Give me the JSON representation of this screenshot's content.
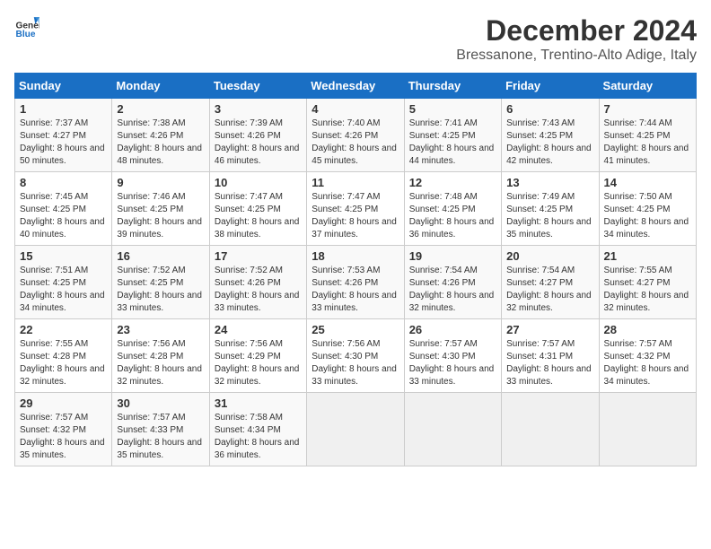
{
  "logo": {
    "text_general": "General",
    "text_blue": "Blue"
  },
  "title": "December 2024",
  "subtitle": "Bressanone, Trentino-Alto Adige, Italy",
  "days_of_week": [
    "Sunday",
    "Monday",
    "Tuesday",
    "Wednesday",
    "Thursday",
    "Friday",
    "Saturday"
  ],
  "weeks": [
    [
      {
        "day": "1",
        "sunrise": "7:37 AM",
        "sunset": "4:27 PM",
        "daylight": "8 hours and 50 minutes."
      },
      {
        "day": "2",
        "sunrise": "7:38 AM",
        "sunset": "4:26 PM",
        "daylight": "8 hours and 48 minutes."
      },
      {
        "day": "3",
        "sunrise": "7:39 AM",
        "sunset": "4:26 PM",
        "daylight": "8 hours and 46 minutes."
      },
      {
        "day": "4",
        "sunrise": "7:40 AM",
        "sunset": "4:26 PM",
        "daylight": "8 hours and 45 minutes."
      },
      {
        "day": "5",
        "sunrise": "7:41 AM",
        "sunset": "4:25 PM",
        "daylight": "8 hours and 44 minutes."
      },
      {
        "day": "6",
        "sunrise": "7:43 AM",
        "sunset": "4:25 PM",
        "daylight": "8 hours and 42 minutes."
      },
      {
        "day": "7",
        "sunrise": "7:44 AM",
        "sunset": "4:25 PM",
        "daylight": "8 hours and 41 minutes."
      }
    ],
    [
      {
        "day": "8",
        "sunrise": "7:45 AM",
        "sunset": "4:25 PM",
        "daylight": "8 hours and 40 minutes."
      },
      {
        "day": "9",
        "sunrise": "7:46 AM",
        "sunset": "4:25 PM",
        "daylight": "8 hours and 39 minutes."
      },
      {
        "day": "10",
        "sunrise": "7:47 AM",
        "sunset": "4:25 PM",
        "daylight": "8 hours and 38 minutes."
      },
      {
        "day": "11",
        "sunrise": "7:47 AM",
        "sunset": "4:25 PM",
        "daylight": "8 hours and 37 minutes."
      },
      {
        "day": "12",
        "sunrise": "7:48 AM",
        "sunset": "4:25 PM",
        "daylight": "8 hours and 36 minutes."
      },
      {
        "day": "13",
        "sunrise": "7:49 AM",
        "sunset": "4:25 PM",
        "daylight": "8 hours and 35 minutes."
      },
      {
        "day": "14",
        "sunrise": "7:50 AM",
        "sunset": "4:25 PM",
        "daylight": "8 hours and 34 minutes."
      }
    ],
    [
      {
        "day": "15",
        "sunrise": "7:51 AM",
        "sunset": "4:25 PM",
        "daylight": "8 hours and 34 minutes."
      },
      {
        "day": "16",
        "sunrise": "7:52 AM",
        "sunset": "4:25 PM",
        "daylight": "8 hours and 33 minutes."
      },
      {
        "day": "17",
        "sunrise": "7:52 AM",
        "sunset": "4:26 PM",
        "daylight": "8 hours and 33 minutes."
      },
      {
        "day": "18",
        "sunrise": "7:53 AM",
        "sunset": "4:26 PM",
        "daylight": "8 hours and 33 minutes."
      },
      {
        "day": "19",
        "sunrise": "7:54 AM",
        "sunset": "4:26 PM",
        "daylight": "8 hours and 32 minutes."
      },
      {
        "day": "20",
        "sunrise": "7:54 AM",
        "sunset": "4:27 PM",
        "daylight": "8 hours and 32 minutes."
      },
      {
        "day": "21",
        "sunrise": "7:55 AM",
        "sunset": "4:27 PM",
        "daylight": "8 hours and 32 minutes."
      }
    ],
    [
      {
        "day": "22",
        "sunrise": "7:55 AM",
        "sunset": "4:28 PM",
        "daylight": "8 hours and 32 minutes."
      },
      {
        "day": "23",
        "sunrise": "7:56 AM",
        "sunset": "4:28 PM",
        "daylight": "8 hours and 32 minutes."
      },
      {
        "day": "24",
        "sunrise": "7:56 AM",
        "sunset": "4:29 PM",
        "daylight": "8 hours and 32 minutes."
      },
      {
        "day": "25",
        "sunrise": "7:56 AM",
        "sunset": "4:30 PM",
        "daylight": "8 hours and 33 minutes."
      },
      {
        "day": "26",
        "sunrise": "7:57 AM",
        "sunset": "4:30 PM",
        "daylight": "8 hours and 33 minutes."
      },
      {
        "day": "27",
        "sunrise": "7:57 AM",
        "sunset": "4:31 PM",
        "daylight": "8 hours and 33 minutes."
      },
      {
        "day": "28",
        "sunrise": "7:57 AM",
        "sunset": "4:32 PM",
        "daylight": "8 hours and 34 minutes."
      }
    ],
    [
      {
        "day": "29",
        "sunrise": "7:57 AM",
        "sunset": "4:32 PM",
        "daylight": "8 hours and 35 minutes."
      },
      {
        "day": "30",
        "sunrise": "7:57 AM",
        "sunset": "4:33 PM",
        "daylight": "8 hours and 35 minutes."
      },
      {
        "day": "31",
        "sunrise": "7:58 AM",
        "sunset": "4:34 PM",
        "daylight": "8 hours and 36 minutes."
      },
      null,
      null,
      null,
      null
    ]
  ]
}
